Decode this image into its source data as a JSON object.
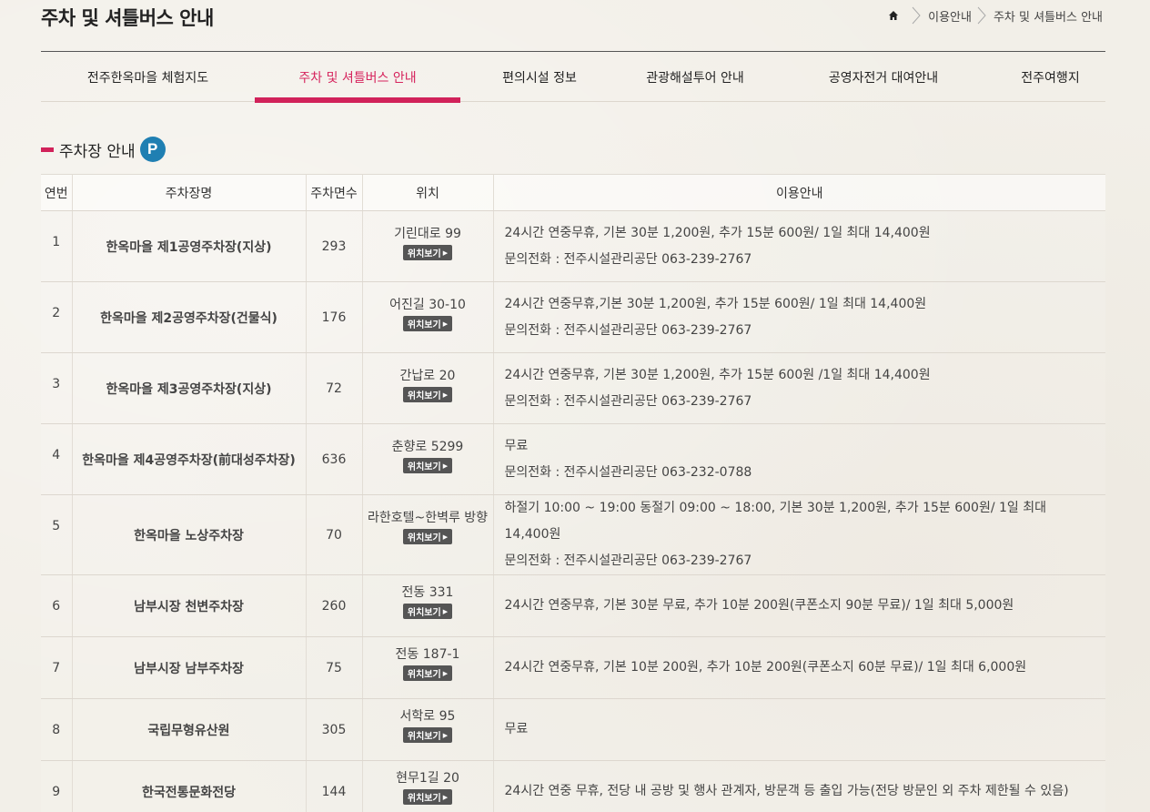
{
  "page": {
    "title": "주차 및 셔틀버스 안내",
    "breadcrumb": [
      "이용안내",
      "주차 및 셔틀버스 안내"
    ]
  },
  "tabs": [
    {
      "label": "전주한옥마을 체험지도",
      "active": false
    },
    {
      "label": "주차 및 셔틀버스 안내",
      "active": true
    },
    {
      "label": "편의시설 정보",
      "active": false
    },
    {
      "label": "관광해설투어 안내",
      "active": false
    },
    {
      "label": "공영자전거 대여안내",
      "active": false
    },
    {
      "label": "전주여행지",
      "active": false
    }
  ],
  "section": {
    "title": "주차장 안내",
    "icon_letter": "P"
  },
  "table": {
    "headers": [
      "연번",
      "주차장명",
      "주차면수",
      "위치",
      "이용안내"
    ],
    "map_button_label": "위치보기",
    "rows": [
      {
        "no": "1",
        "name": "한옥마을 제1공영주차장(지상)",
        "count": "293",
        "location": "기린대로 99",
        "info": [
          "24시간 연중무휴, 기본 30분 1,200원, 추가 15분 600원/ 1일 최대 14,400원",
          "문의전화 : 전주시설관리공단 063-239-2767"
        ]
      },
      {
        "no": "2",
        "name": "한옥마을 제2공영주차장(건물식)",
        "count": "176",
        "location": "어진길 30-10",
        "info": [
          "24시간 연중무휴,기본 30분 1,200원, 추가 15분 600원/ 1일 최대 14,400원",
          "문의전화 : 전주시설관리공단 063-239-2767"
        ]
      },
      {
        "no": "3",
        "name": "한옥마을 제3공영주차장(지상)",
        "count": "72",
        "location": "간납로 20",
        "info": [
          "24시간 연중무휴, 기본 30분 1,200원, 추가 15분 600원 /1일 최대 14,400원",
          "문의전화 : 전주시설관리공단 063-239-2767"
        ]
      },
      {
        "no": "4",
        "name": "한옥마을 제4공영주차장(前대성주차장)",
        "count": "636",
        "location": "춘향로 5299",
        "info": [
          "무료",
          "문의전화 : 전주시설관리공단 063-232-0788"
        ]
      },
      {
        "no": "5",
        "name": "한옥마을 노상주차장",
        "count": "70",
        "location": "라한호텔~한벽루 방향",
        "info": [
          "하절기 10:00 ~ 19:00 동절기 09:00 ~ 18:00, 기본 30분 1,200원, 추가 15분 600원/ 1일 최대 14,400원",
          "문의전화 : 전주시설관리공단 063-239-2767"
        ]
      },
      {
        "no": "6",
        "name": "남부시장 천변주차장",
        "count": "260",
        "location": "전동 331",
        "info": [
          "24시간 연중무휴, 기본 30분 무료, 추가 10분 200원(쿠폰소지 90분 무료)/ 1일 최대 5,000원"
        ]
      },
      {
        "no": "7",
        "name": "남부시장 남부주차장",
        "count": "75",
        "location": "전동 187-1",
        "info": [
          "24시간 연중무휴, 기본 10분 200원, 추가 10분 200원(쿠폰소지 60분 무료)/ 1일 최대 6,000원"
        ]
      },
      {
        "no": "8",
        "name": "국립무형유산원",
        "count": "305",
        "location": "서학로 95",
        "info": [
          "무료"
        ]
      },
      {
        "no": "9",
        "name": "한국전통문화전당",
        "count": "144",
        "location": "현무1길 20",
        "info": [
          "24시간 연중 무휴, 전당 내 공방 및 행사 관계자, 방문객 등 출입 가능(전당 방문인 외 주차 제한될 수 있음)"
        ]
      }
    ]
  },
  "colors": {
    "accent": "#d1225a",
    "parking_icon": "#1f7fb2",
    "button": "#555555"
  }
}
